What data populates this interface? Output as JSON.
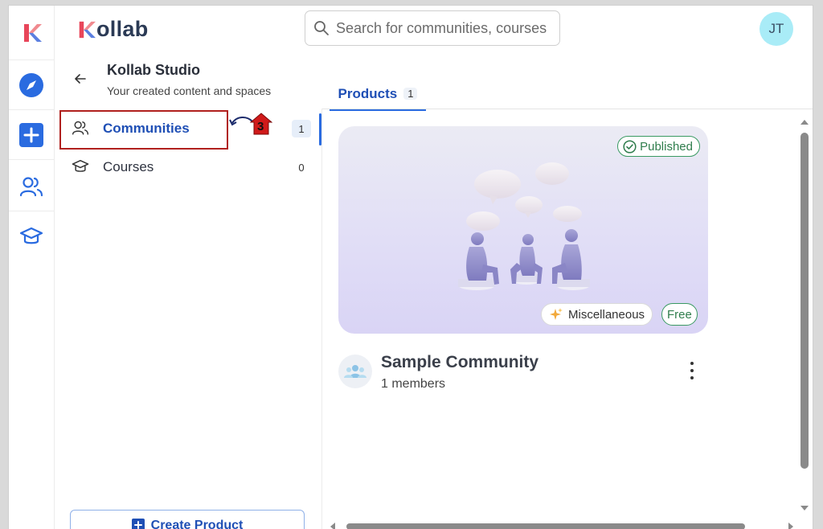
{
  "app": {
    "logo_text": "ollab",
    "logo_mark": "K"
  },
  "search": {
    "placeholder": "Search for communities, courses"
  },
  "user": {
    "initials": "JT"
  },
  "studio": {
    "title": "Kollab Studio",
    "subtitle": "Your created content and spaces"
  },
  "nav": [
    {
      "label": "Communities",
      "count": "1",
      "icon": "users-icon",
      "active": true
    },
    {
      "label": "Courses",
      "count": "0",
      "icon": "graduation-cap-icon",
      "active": false
    }
  ],
  "annotation": {
    "step": "3"
  },
  "create_button": {
    "label": "Create Product"
  },
  "tabs": [
    {
      "label": "Products",
      "count": "1"
    }
  ],
  "product_card": {
    "status": "Published",
    "category": "Miscellaneous",
    "category_icon": "sparkles-icon",
    "price": "Free",
    "name": "Sample Community",
    "members": "1 members"
  },
  "colors": {
    "accent": "#2a6be0",
    "brand_red": "#e8465a",
    "success": "#2f7d4c",
    "highlight": "#b0201e"
  }
}
